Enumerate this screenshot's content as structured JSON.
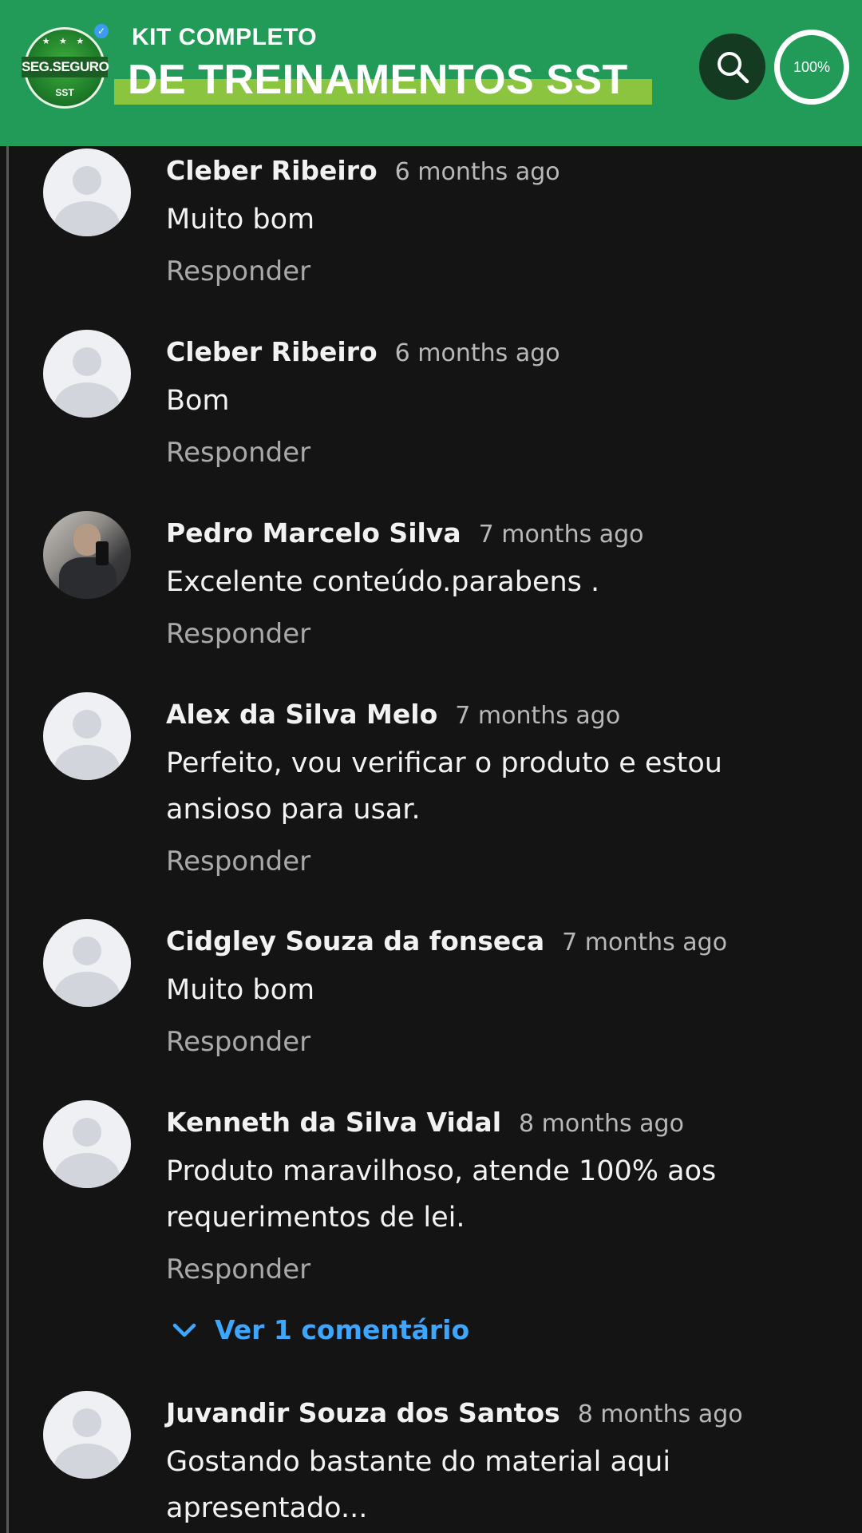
{
  "header": {
    "logo_text": "SEG.SEGURO",
    "logo_sub": "SST",
    "title_line1": "KIT COMPLETO",
    "title_line2": "DE TREINAMENTOS SST",
    "zoom_level": "100%",
    "colors": {
      "header_bg": "#229b58",
      "title_highlight": "#8bc43f",
      "search_bg": "#143a22"
    }
  },
  "comments": [
    {
      "author": "Cleber Ribeiro",
      "time": "6 months ago",
      "text": "Muito bom",
      "reply": "Responder"
    },
    {
      "author": "Cleber Ribeiro",
      "time": "6 months ago",
      "text": "Bom",
      "reply": "Responder"
    },
    {
      "author": "Pedro Marcelo Silva",
      "time": "7 months ago",
      "text": "Excelente conteúdo.parabens .",
      "reply": "Responder"
    },
    {
      "author": "Alex da Silva Melo",
      "time": "7 months ago",
      "text": "Perfeito, vou verificar o produto e estou ansioso para usar.",
      "reply": "Responder"
    },
    {
      "author": "Cidgley Souza da fonseca",
      "time": "7 months ago",
      "text": "Muito bom",
      "reply": "Responder"
    },
    {
      "author": "Kenneth da Silva Vidal",
      "time": "8 months ago",
      "text": "Produto maravilhoso, atende 100% aos requerimentos de lei.",
      "reply": "Responder"
    },
    {
      "author": "Juvandir Souza dos Santos",
      "time": "8 months ago",
      "text": "Gostando bastante do material aqui apresentado...",
      "reply": ""
    }
  ],
  "view_replies_label": "Ver 1 comentário",
  "icons": [
    "search-icon",
    "chevron-down-icon",
    "verified-icon",
    "default-avatar-icon"
  ]
}
